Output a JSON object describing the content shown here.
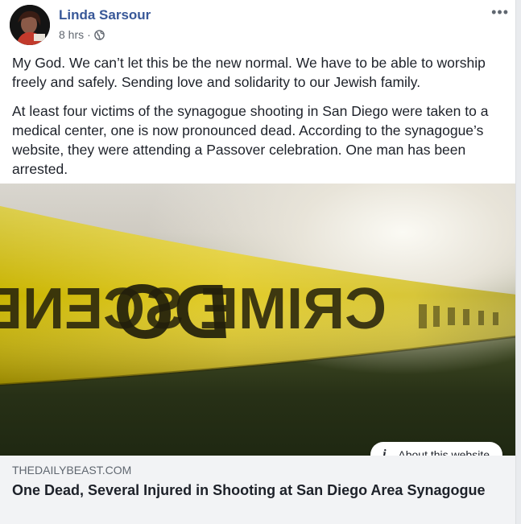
{
  "post": {
    "author": "Linda Sarsour",
    "time": "8 hrs",
    "separator": "·",
    "privacy_icon": "globe-icon",
    "more_icon": "ellipsis-icon",
    "more_label": "•••",
    "paragraphs": [
      "My God. We can’t let this be the new normal. We have to be able to worship freely and safely. Sending love and solidarity to our Jewish family.",
      "At least four victims of the synagogue shooting in San Diego were taken to a medical center, one is now pronounced dead. According to the synagogue’s website, they were attending a Passover celebration. One man has been arrested."
    ]
  },
  "link": {
    "image_text": "CRIME SCENE DO",
    "about_label": "About this website",
    "about_icon": "i",
    "domain": "THEDAILYBEAST.COM",
    "title": "One Dead, Several Injured in Shooting at San Diego Area Synagogue"
  },
  "colors": {
    "author": "#385898",
    "tape": "#d9c21a",
    "caption_bg": "#f2f3f5"
  }
}
